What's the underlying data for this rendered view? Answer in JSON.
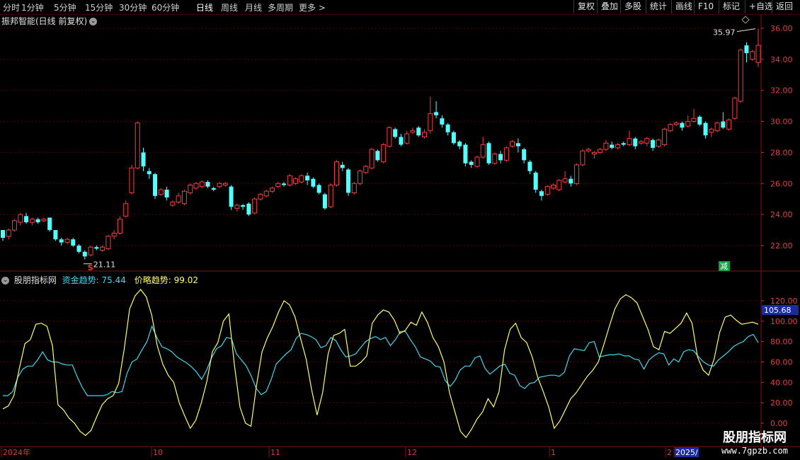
{
  "toolbar": {
    "periods": [
      "分时",
      "1分钟",
      "5分钟",
      "15分钟",
      "30分钟",
      "60分钟",
      "日线",
      "周线",
      "月线",
      "多周期",
      "更多 >"
    ],
    "active_period": "日线",
    "right_buttons": [
      "复权",
      "叠加",
      "多股",
      "统计",
      "画线",
      "F10",
      "标记",
      "+自选",
      "返回"
    ]
  },
  "main_title": "振邦智能(日线 前复权)",
  "price_axis": [
    "36.00",
    "34.00",
    "32.00",
    "30.00",
    "28.00",
    "26.00",
    "24.00",
    "22.00"
  ],
  "markers": {
    "high_label": "35.97",
    "low_label": "21.11",
    "s_signal": "S",
    "jian_label": "减"
  },
  "indicator": {
    "name": "股朋指标网",
    "fund_label": "资金趋势:",
    "fund_value": "75.44",
    "price_label": "价略趋势:",
    "price_value": "99.02",
    "axis": [
      "120.00",
      "100.00",
      "80.00",
      "60.00",
      "40.00",
      "20.00",
      "0.00"
    ],
    "current_value": "105.68"
  },
  "date_axis": [
    "2024年",
    "10",
    "11",
    "12",
    "1",
    "2",
    "2025/"
  ],
  "watermark": {
    "line1": "股朋指标网",
    "line2": "www.7gpzb.com"
  },
  "colors": {
    "up": "#ff3b3b",
    "down": "#54ffff",
    "yellow_line": "#ffff66",
    "cyan_line": "#40d8f0",
    "grid": "#5a0000",
    "axis_text": "#e04040"
  },
  "chart_data": {
    "type": "candlestick",
    "ylim": [
      21,
      36.5
    ],
    "candles": [
      [
        23.0,
        22.5,
        23.0,
        22.3
      ],
      [
        22.6,
        23.0,
        23.1,
        22.4
      ],
      [
        23.0,
        23.6,
        23.7,
        22.9
      ],
      [
        23.5,
        24.0,
        24.1,
        23.3
      ],
      [
        23.9,
        23.5,
        24.1,
        23.4
      ],
      [
        23.5,
        23.7,
        23.8,
        23.3
      ],
      [
        23.7,
        23.5,
        23.8,
        23.4
      ],
      [
        23.6,
        23.7,
        23.8,
        23.5
      ],
      [
        23.8,
        23.0,
        23.8,
        22.9
      ],
      [
        23.0,
        22.4,
        23.0,
        22.3
      ],
      [
        22.4,
        22.2,
        22.5,
        22.0
      ],
      [
        22.2,
        22.4,
        22.5,
        22.1
      ],
      [
        22.4,
        22.0,
        22.5,
        21.9
      ],
      [
        22.0,
        21.6,
        22.1,
        21.5
      ],
      [
        21.6,
        21.3,
        21.7,
        21.1
      ],
      [
        21.4,
        21.9,
        22.0,
        21.3
      ],
      [
        21.9,
        21.8,
        22.0,
        21.7
      ],
      [
        21.7,
        21.9,
        22.0,
        21.6
      ],
      [
        21.8,
        22.6,
        22.7,
        21.7
      ],
      [
        22.6,
        22.8,
        23.0,
        22.4
      ],
      [
        22.8,
        23.7,
        23.9,
        22.7
      ],
      [
        23.9,
        24.7,
        24.9,
        23.8
      ],
      [
        25.4,
        27.0,
        27.2,
        25.3
      ],
      [
        27.0,
        29.9,
        30.0,
        26.9
      ],
      [
        28.0,
        27.1,
        28.3,
        26.8
      ],
      [
        26.8,
        26.6,
        27.0,
        26.3
      ],
      [
        26.6,
        25.2,
        26.7,
        25.0
      ],
      [
        25.3,
        25.6,
        25.7,
        25.2
      ],
      [
        25.6,
        25.1,
        25.8,
        24.9
      ],
      [
        24.6,
        24.8,
        24.9,
        24.5
      ],
      [
        24.8,
        25.2,
        25.4,
        24.7
      ],
      [
        24.7,
        25.5,
        25.6,
        24.6
      ],
      [
        25.4,
        25.9,
        26.0,
        25.3
      ],
      [
        25.7,
        26.0,
        26.1,
        25.6
      ],
      [
        25.8,
        26.1,
        26.2,
        25.7
      ],
      [
        26.1,
        25.8,
        26.2,
        25.7
      ],
      [
        25.7,
        25.6,
        25.8,
        25.5
      ],
      [
        25.8,
        26.0,
        26.1,
        25.7
      ],
      [
        25.9,
        26.0,
        26.1,
        25.8
      ],
      [
        25.8,
        24.5,
        25.9,
        24.3
      ],
      [
        24.4,
        24.6,
        24.7,
        24.2
      ],
      [
        24.6,
        24.5,
        24.7,
        24.3
      ],
      [
        24.7,
        24.0,
        24.8,
        23.9
      ],
      [
        24.1,
        25.0,
        25.1,
        24.0
      ],
      [
        25.0,
        25.3,
        25.4,
        24.9
      ],
      [
        25.2,
        25.5,
        25.6,
        25.1
      ],
      [
        25.5,
        25.7,
        25.8,
        25.4
      ],
      [
        25.8,
        26.0,
        26.1,
        25.7
      ],
      [
        26.0,
        25.9,
        26.1,
        25.8
      ],
      [
        25.9,
        26.5,
        26.6,
        25.8
      ],
      [
        26.0,
        26.3,
        26.4,
        25.9
      ],
      [
        26.1,
        26.5,
        26.6,
        26.0
      ],
      [
        26.5,
        26.2,
        26.7,
        25.9
      ],
      [
        26.3,
        25.8,
        26.4,
        25.7
      ],
      [
        25.9,
        25.4,
        26.0,
        25.3
      ],
      [
        25.3,
        24.4,
        25.4,
        24.3
      ],
      [
        24.5,
        25.9,
        26.0,
        24.4
      ],
      [
        25.9,
        27.4,
        27.5,
        25.8
      ],
      [
        27.2,
        27.0,
        27.4,
        26.8
      ],
      [
        26.9,
        25.4,
        27.0,
        25.2
      ],
      [
        25.4,
        26.0,
        26.1,
        25.3
      ],
      [
        26.0,
        26.8,
        26.9,
        25.9
      ],
      [
        26.7,
        27.1,
        27.2,
        26.6
      ],
      [
        27.0,
        28.2,
        28.3,
        26.9
      ],
      [
        28.1,
        27.5,
        28.2,
        27.4
      ],
      [
        27.4,
        28.5,
        28.6,
        27.3
      ],
      [
        28.4,
        29.6,
        29.7,
        28.3
      ],
      [
        29.5,
        29.0,
        29.6,
        28.9
      ],
      [
        29.0,
        28.5,
        29.2,
        28.4
      ],
      [
        28.6,
        29.2,
        29.4,
        28.5
      ],
      [
        29.3,
        29.4,
        29.6,
        29.2
      ],
      [
        29.6,
        29.1,
        29.7,
        29.0
      ],
      [
        29.0,
        29.3,
        29.5,
        28.9
      ],
      [
        29.4,
        30.5,
        31.6,
        29.2
      ],
      [
        30.6,
        30.4,
        31.3,
        30.2
      ],
      [
        30.2,
        29.8,
        30.4,
        29.6
      ],
      [
        29.8,
        29.3,
        29.9,
        29.1
      ],
      [
        29.3,
        28.6,
        29.4,
        28.5
      ],
      [
        28.7,
        28.4,
        28.8,
        28.2
      ],
      [
        28.5,
        27.3,
        28.6,
        27.1
      ],
      [
        27.4,
        27.2,
        27.5,
        27.0
      ],
      [
        27.1,
        27.7,
        27.8,
        27.0
      ],
      [
        27.7,
        28.5,
        29.0,
        27.6
      ],
      [
        28.6,
        27.3,
        28.7,
        27.2
      ],
      [
        27.3,
        27.9,
        28.0,
        27.2
      ],
      [
        27.9,
        27.5,
        28.1,
        27.3
      ],
      [
        27.5,
        28.3,
        28.4,
        27.4
      ],
      [
        28.4,
        28.7,
        28.8,
        28.3
      ],
      [
        28.6,
        28.4,
        28.9,
        28.0
      ],
      [
        28.2,
        27.5,
        28.3,
        27.3
      ],
      [
        27.4,
        26.8,
        27.5,
        26.6
      ],
      [
        26.7,
        25.6,
        26.8,
        25.4
      ],
      [
        25.5,
        25.2,
        25.6,
        24.9
      ],
      [
        25.3,
        25.8,
        25.9,
        25.2
      ],
      [
        25.7,
        25.9,
        26.0,
        25.6
      ],
      [
        25.6,
        26.2,
        26.3,
        25.5
      ],
      [
        26.1,
        26.3,
        26.8,
        26.0
      ],
      [
        26.3,
        26.0,
        26.5,
        25.8
      ],
      [
        26.0,
        27.2,
        27.3,
        25.9
      ],
      [
        27.2,
        28.1,
        28.2,
        27.1
      ],
      [
        28.1,
        28.2,
        28.3,
        28.0
      ],
      [
        27.9,
        28.0,
        28.1,
        27.6
      ],
      [
        28.0,
        28.2,
        28.3,
        27.9
      ],
      [
        28.2,
        28.6,
        28.8,
        28.1
      ],
      [
        28.5,
        28.3,
        28.7,
        28.2
      ],
      [
        28.3,
        28.5,
        28.6,
        28.2
      ],
      [
        28.6,
        28.5,
        28.7,
        28.4
      ],
      [
        28.5,
        28.9,
        29.4,
        28.4
      ],
      [
        28.9,
        28.4,
        29.0,
        28.2
      ],
      [
        28.6,
        28.7,
        28.8,
        28.5
      ],
      [
        28.6,
        28.9,
        29.0,
        28.4
      ],
      [
        28.8,
        28.3,
        28.9,
        28.1
      ],
      [
        28.4,
        28.8,
        28.9,
        28.3
      ],
      [
        28.5,
        29.5,
        29.6,
        28.4
      ],
      [
        29.4,
        29.8,
        29.9,
        29.3
      ],
      [
        29.8,
        29.9,
        30.0,
        29.7
      ],
      [
        29.9,
        29.6,
        30.0,
        29.4
      ],
      [
        29.7,
        30.0,
        30.4,
        29.6
      ],
      [
        30.0,
        30.2,
        30.8,
        29.9
      ],
      [
        30.3,
        29.8,
        30.4,
        29.7
      ],
      [
        29.9,
        29.1,
        30.0,
        28.9
      ],
      [
        29.3,
        29.5,
        29.6,
        29.0
      ],
      [
        29.4,
        29.9,
        30.0,
        29.3
      ],
      [
        30.0,
        29.6,
        30.6,
        29.5
      ],
      [
        29.5,
        30.1,
        30.2,
        29.4
      ],
      [
        30.2,
        31.5,
        31.6,
        30.1
      ],
      [
        31.3,
        34.6,
        34.7,
        31.2
      ],
      [
        34.9,
        34.4,
        35.1,
        33.8
      ],
      [
        34.0,
        34.5,
        34.6,
        33.9
      ],
      [
        33.8,
        34.9,
        35.97,
        33.5
      ]
    ],
    "fund_trend": [
      27,
      27,
      31,
      45,
      53,
      56,
      56,
      62,
      70,
      62,
      60,
      60,
      58,
      57,
      57,
      45,
      35,
      27,
      27,
      27,
      27,
      28,
      31,
      30,
      31,
      49,
      60,
      63,
      72,
      80,
      95,
      84,
      75,
      73,
      70,
      65,
      62,
      59,
      55,
      50,
      43,
      52,
      64,
      73,
      76,
      84,
      83,
      68,
      62,
      56,
      46,
      34,
      28,
      31,
      43,
      58,
      63,
      68,
      72,
      83,
      88,
      87,
      85,
      82,
      74,
      76,
      84,
      81,
      72,
      65,
      66,
      68,
      74,
      80,
      83,
      85,
      82,
      84,
      76,
      82,
      90,
      90,
      82,
      75,
      65,
      63,
      61,
      56,
      55,
      42,
      36,
      42,
      52,
      56,
      56,
      64,
      66,
      54,
      48,
      52,
      56,
      58,
      49,
      47,
      37,
      34,
      39,
      40,
      45,
      46,
      47,
      47,
      46,
      50,
      66,
      73,
      72,
      71,
      79,
      80,
      65,
      66,
      67,
      67,
      68,
      66,
      66,
      63,
      62,
      53,
      62,
      66,
      69,
      68,
      57,
      63,
      60,
      70,
      72,
      71,
      65,
      60,
      57,
      56,
      62,
      66,
      70,
      75,
      78,
      80,
      85,
      87,
      79
    ],
    "price_trend": [
      14,
      17,
      27,
      54,
      78,
      82,
      97,
      98,
      95,
      76,
      18,
      13,
      5,
      0,
      -8,
      -12,
      -7,
      6,
      18,
      24,
      27,
      39,
      72,
      112,
      125,
      131,
      124,
      106,
      76,
      58,
      47,
      40,
      20,
      7,
      -5,
      3,
      20,
      41,
      70,
      79,
      100,
      107,
      57,
      16,
      0,
      -3,
      37,
      70,
      84,
      95,
      109,
      120,
      116,
      104,
      83,
      63,
      33,
      8,
      30,
      68,
      86,
      88,
      92,
      56,
      56,
      60,
      66,
      98,
      106,
      111,
      109,
      101,
      88,
      91,
      99,
      96,
      109,
      99,
      84,
      75,
      60,
      30,
      11,
      -8,
      -14,
      -6,
      4,
      11,
      24,
      16,
      31,
      72,
      92,
      98,
      84,
      79,
      65,
      45,
      31,
      16,
      -5,
      2,
      13,
      24,
      30,
      38,
      46,
      52,
      60,
      77,
      95,
      112,
      122,
      126,
      123,
      118,
      105,
      92,
      75,
      72,
      90,
      88,
      93,
      98,
      108,
      98,
      65,
      52,
      47,
      63,
      89,
      104,
      106,
      101,
      97,
      98,
      99,
      97
    ]
  }
}
